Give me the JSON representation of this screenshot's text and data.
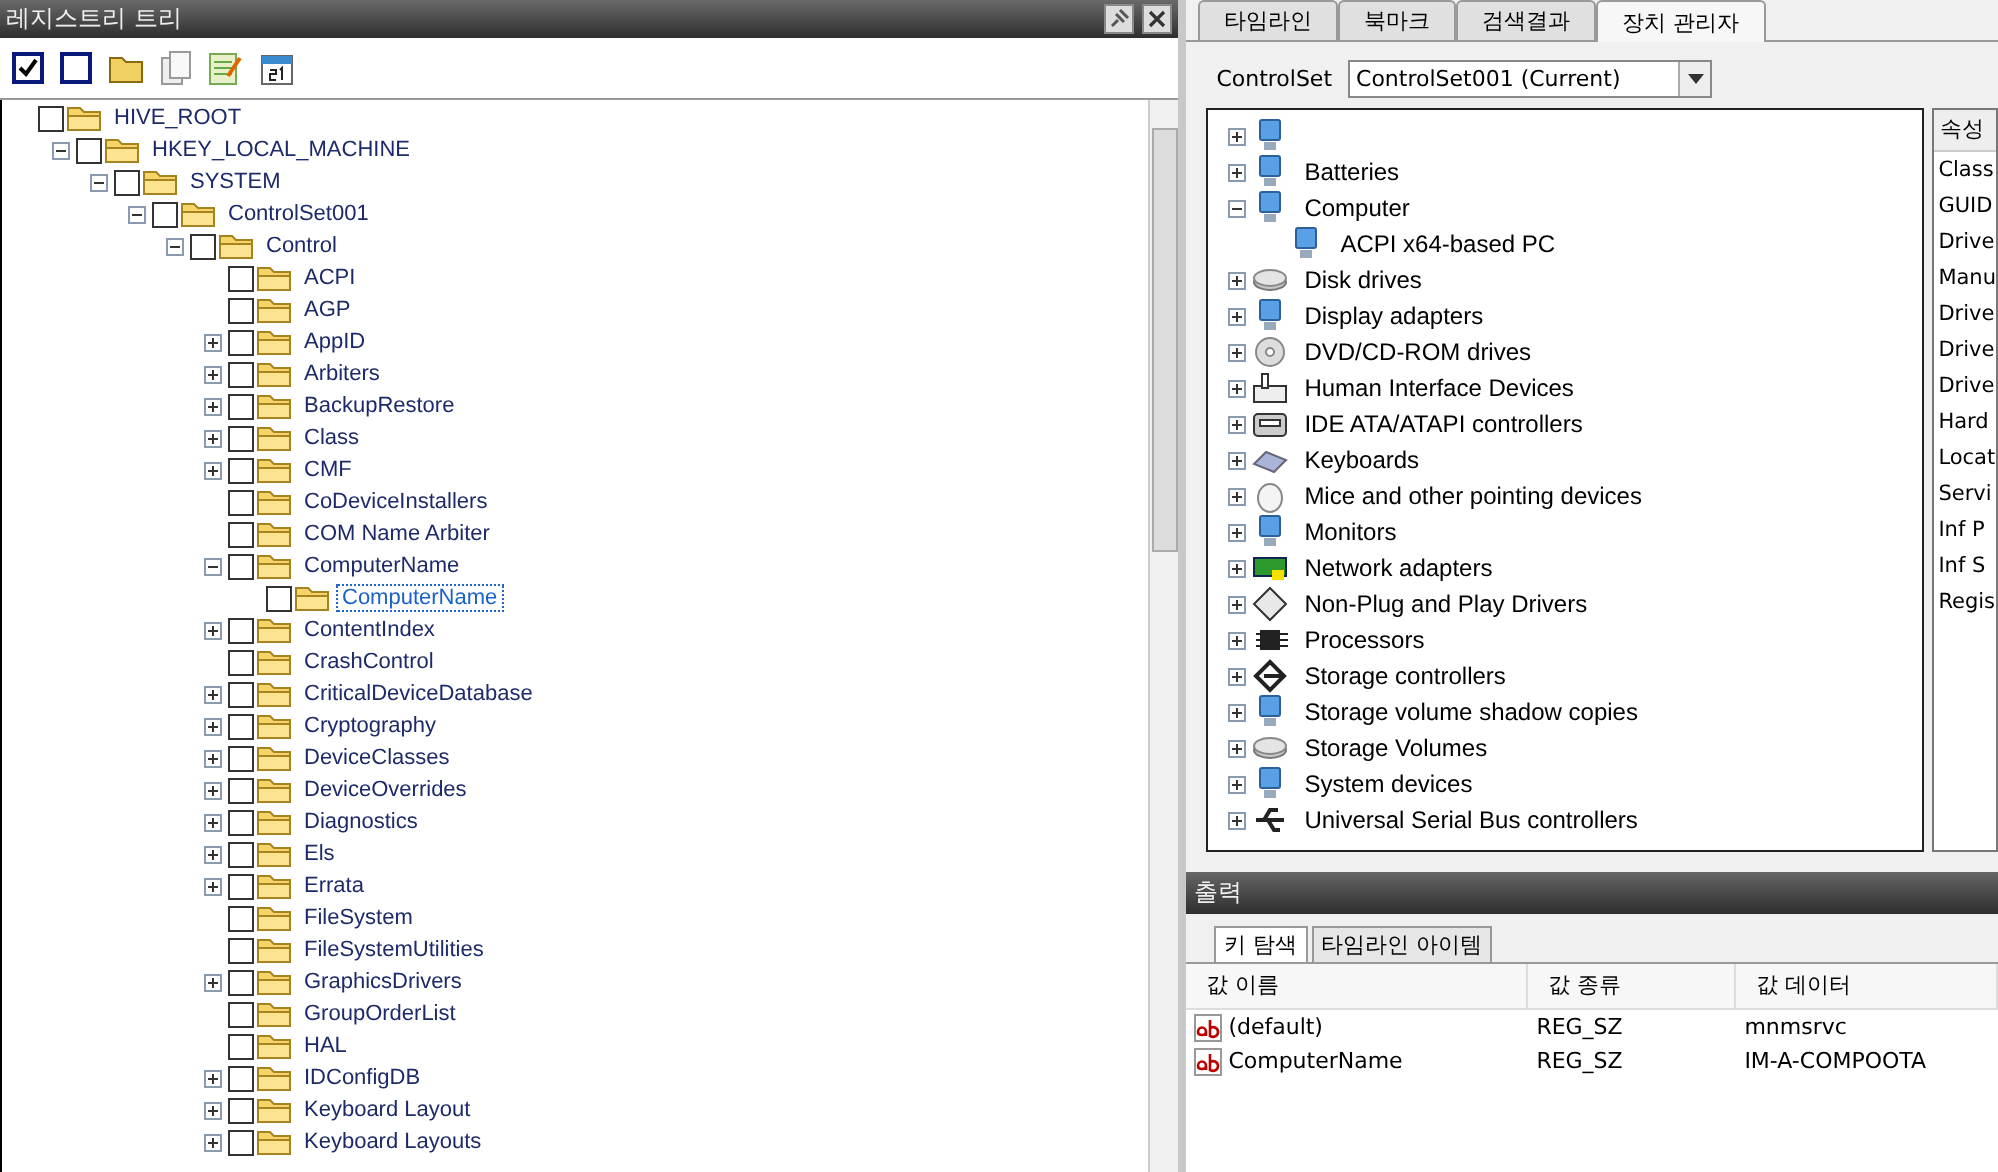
{
  "registry_panel": {
    "title": "레지스트리 트리",
    "tree": [
      {
        "label": "HIVE_ROOT",
        "checked": false,
        "expandable": false,
        "selected": false,
        "children": [
          {
            "label": "HKEY_LOCAL_MACHINE",
            "checked": false,
            "expandable": true,
            "expanded": true,
            "selected": false,
            "children": [
              {
                "label": "SYSTEM",
                "checked": false,
                "expandable": true,
                "expanded": true,
                "selected": false,
                "children": [
                  {
                    "label": "ControlSet001",
                    "checked": false,
                    "expandable": true,
                    "expanded": true,
                    "selected": false,
                    "children": [
                      {
                        "label": "Control",
                        "checked": false,
                        "expandable": true,
                        "expanded": true,
                        "selected": false,
                        "children": [
                          {
                            "label": "ACPI",
                            "checked": false,
                            "expandable": false,
                            "selected": false
                          },
                          {
                            "label": "AGP",
                            "checked": false,
                            "expandable": false,
                            "selected": false
                          },
                          {
                            "label": "AppID",
                            "checked": false,
                            "expandable": true,
                            "expanded": false,
                            "selected": false
                          },
                          {
                            "label": "Arbiters",
                            "checked": false,
                            "expandable": true,
                            "expanded": false,
                            "selected": false
                          },
                          {
                            "label": "BackupRestore",
                            "checked": false,
                            "expandable": true,
                            "expanded": false,
                            "selected": false
                          },
                          {
                            "label": "Class",
                            "checked": false,
                            "expandable": true,
                            "expanded": false,
                            "selected": false
                          },
                          {
                            "label": "CMF",
                            "checked": false,
                            "expandable": true,
                            "expanded": false,
                            "selected": false
                          },
                          {
                            "label": "CoDeviceInstallers",
                            "checked": false,
                            "expandable": false,
                            "selected": false
                          },
                          {
                            "label": "COM Name Arbiter",
                            "checked": false,
                            "expandable": false,
                            "selected": false
                          },
                          {
                            "label": "ComputerName",
                            "checked": false,
                            "expandable": true,
                            "expanded": true,
                            "selected": false,
                            "children": [
                              {
                                "label": "ComputerName",
                                "checked": false,
                                "expandable": false,
                                "selected": true
                              }
                            ]
                          },
                          {
                            "label": "ContentIndex",
                            "checked": false,
                            "expandable": true,
                            "expanded": false,
                            "selected": false
                          },
                          {
                            "label": "CrashControl",
                            "checked": false,
                            "expandable": false,
                            "selected": false
                          },
                          {
                            "label": "CriticalDeviceDatabase",
                            "checked": false,
                            "expandable": true,
                            "expanded": false,
                            "selected": false
                          },
                          {
                            "label": "Cryptography",
                            "checked": false,
                            "expandable": true,
                            "expanded": false,
                            "selected": false
                          },
                          {
                            "label": "DeviceClasses",
                            "checked": false,
                            "expandable": true,
                            "expanded": false,
                            "selected": false
                          },
                          {
                            "label": "DeviceOverrides",
                            "checked": false,
                            "expandable": true,
                            "expanded": false,
                            "selected": false
                          },
                          {
                            "label": "Diagnostics",
                            "checked": false,
                            "expandable": true,
                            "expanded": false,
                            "selected": false
                          },
                          {
                            "label": "Els",
                            "checked": false,
                            "expandable": true,
                            "expanded": false,
                            "selected": false
                          },
                          {
                            "label": "Errata",
                            "checked": false,
                            "expandable": true,
                            "expanded": false,
                            "selected": false
                          },
                          {
                            "label": "FileSystem",
                            "checked": false,
                            "expandable": false,
                            "selected": false
                          },
                          {
                            "label": "FileSystemUtilities",
                            "checked": false,
                            "expandable": false,
                            "selected": false
                          },
                          {
                            "label": "GraphicsDrivers",
                            "checked": false,
                            "expandable": true,
                            "expanded": false,
                            "selected": false
                          },
                          {
                            "label": "GroupOrderList",
                            "checked": false,
                            "expandable": false,
                            "selected": false
                          },
                          {
                            "label": "HAL",
                            "checked": false,
                            "expandable": false,
                            "selected": false
                          },
                          {
                            "label": "IDConfigDB",
                            "checked": false,
                            "expandable": true,
                            "expanded": false,
                            "selected": false
                          },
                          {
                            "label": "Keyboard Layout",
                            "checked": false,
                            "expandable": true,
                            "expanded": false,
                            "selected": false
                          },
                          {
                            "label": "Keyboard Layouts",
                            "checked": false,
                            "expandable": true,
                            "expanded": false,
                            "selected": false
                          }
                        ]
                      }
                    ]
                  }
                ]
              }
            ]
          }
        ]
      }
    ]
  },
  "tabs": [
    {
      "label": "타임라인",
      "selected": false
    },
    {
      "label": "북마크",
      "selected": false
    },
    {
      "label": "검색결과",
      "selected": false
    },
    {
      "label": "장치 관리자",
      "selected": true
    }
  ],
  "controlset": {
    "label": "ControlSet",
    "value": "ControlSet001 (Current)"
  },
  "devices": [
    {
      "kind": "computer",
      "expanded": false
    },
    {
      "label": "Batteries",
      "kind": "computer",
      "expanded": false
    },
    {
      "label": "Computer",
      "kind": "computer",
      "expanded": true,
      "children": [
        {
          "label": "ACPI x64-based PC",
          "kind": "computer"
        }
      ]
    },
    {
      "label": "Disk drives",
      "kind": "disk",
      "expanded": false
    },
    {
      "label": "Display adapters",
      "kind": "computer",
      "expanded": false
    },
    {
      "label": "DVD/CD-ROM drives",
      "kind": "disc",
      "expanded": false
    },
    {
      "label": "Human Interface Devices",
      "kind": "hid",
      "expanded": false
    },
    {
      "label": "IDE ATA/ATAPI controllers",
      "kind": "ide",
      "expanded": false
    },
    {
      "label": "Keyboards",
      "kind": "keyboard",
      "expanded": false
    },
    {
      "label": "Mice and other pointing devices",
      "kind": "mouse",
      "expanded": false
    },
    {
      "label": "Monitors",
      "kind": "computer",
      "expanded": false
    },
    {
      "label": "Network adapters",
      "kind": "network",
      "expanded": false
    },
    {
      "label": "Non-Plug and Play Drivers",
      "kind": "diamond",
      "expanded": false
    },
    {
      "label": "Processors",
      "kind": "chip",
      "expanded": false
    },
    {
      "label": "Storage controllers",
      "kind": "storage",
      "expanded": false
    },
    {
      "label": "Storage volume shadow copies",
      "kind": "computer",
      "expanded": false
    },
    {
      "label": "Storage Volumes",
      "kind": "disk",
      "expanded": false
    },
    {
      "label": "System devices",
      "kind": "computer",
      "expanded": false
    },
    {
      "label": "Universal Serial Bus controllers",
      "kind": "usb",
      "expanded": false
    }
  ],
  "properties": {
    "header": "속성",
    "items": [
      "Class",
      "GUID",
      "Drive",
      "Manu",
      "Drive",
      "Drive",
      "Drive",
      "Hard",
      "Locat",
      "Servi",
      "Inf P",
      "Inf S",
      "Regis"
    ]
  },
  "output": {
    "title": "출력",
    "tabs": [
      {
        "label": "키 탐색",
        "selected": true
      },
      {
        "label": "타임라인 아이템",
        "selected": false
      }
    ],
    "columns": [
      "값 이름",
      "값 종류",
      "값 데이터"
    ],
    "rows": [
      [
        "(default)",
        "REG_SZ",
        "mnmsrvc"
      ],
      [
        "ComputerName",
        "REG_SZ",
        "IM-A-COMPOOTA"
      ]
    ]
  }
}
